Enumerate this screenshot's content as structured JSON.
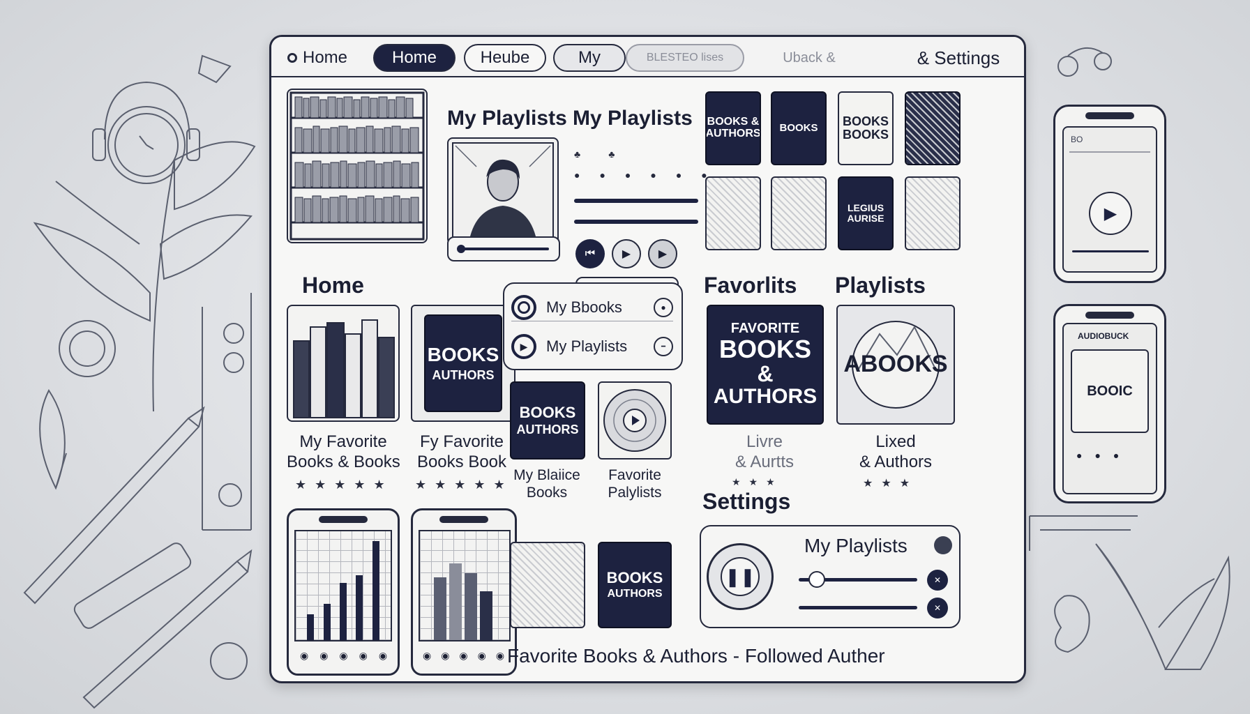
{
  "tabs": [
    {
      "label": "Home"
    },
    {
      "label": "Home"
    },
    {
      "label": "Heube"
    },
    {
      "label": "My"
    },
    {
      "label": "BLESTEO lises"
    },
    {
      "label": "Uback  &"
    },
    {
      "label": "& Settings"
    }
  ],
  "top": {
    "playlists_heading_1": "My Playlists",
    "playlists_heading_2": "My Playlists",
    "covers_row1": [
      "BOOKS & AUTHORS",
      "BOOKS",
      "BOOKS BOOKS",
      ""
    ],
    "covers_row2": [
      "",
      "",
      "LEGIUS AURISE",
      ""
    ]
  },
  "home": {
    "heading": "Home",
    "cover_books_authors": "BOOKS",
    "cover_books_authors_sub": "AUTHORS",
    "label_1_line1": "My Favorite",
    "label_1_line2": "Books & Books",
    "label_2_line1": "Fy Favorite",
    "label_2_line2": "Books Book",
    "stars_1": "★★★★★",
    "stars_2": "★★★★★"
  },
  "list_panel": {
    "items": [
      {
        "label": "My Bbooks"
      },
      {
        "label": "My Playlists"
      }
    ]
  },
  "middle": {
    "cover_1": "BOOKS",
    "cover_1_sub": "AUTHORS",
    "cover_1_label_line1": "My Blaiice",
    "cover_1_label_line2": "Books",
    "cover_2_label_line1": "Favorite",
    "cover_2_label_line2": "Palylists",
    "cover_3": "BOOKS",
    "cover_3_sub": "AUTHORS"
  },
  "favorites": {
    "heading": "Favorlits",
    "cover_top": "FAVORITE",
    "cover_main": "BOOKS",
    "cover_amp": "&",
    "cover_bottom": "AUTHORS",
    "label_line1": "Livre",
    "label_line2": "& Aurtts",
    "stars": "★★★"
  },
  "playlists": {
    "heading": "Playlists",
    "cover_text": "ABOOKS",
    "label_line1": "Lixed",
    "label_line2": "& Authors",
    "stars": "★★★"
  },
  "settings": {
    "heading": "Settings",
    "player_title": "My Playlists"
  },
  "footer": {
    "text": "Favorite Books & Authors - Followed Auther"
  },
  "phones": {
    "top_header": "BO",
    "bottom_header": "AUDIOBUCK",
    "bottom_cover": "BOOIC"
  },
  "chart": {
    "bar_heights": [
      0.25,
      0.35,
      0.55,
      0.62,
      0.95
    ]
  },
  "colors": {
    "accent": "#1d2240",
    "background": "#f7f7f6",
    "border": "#25293d"
  }
}
